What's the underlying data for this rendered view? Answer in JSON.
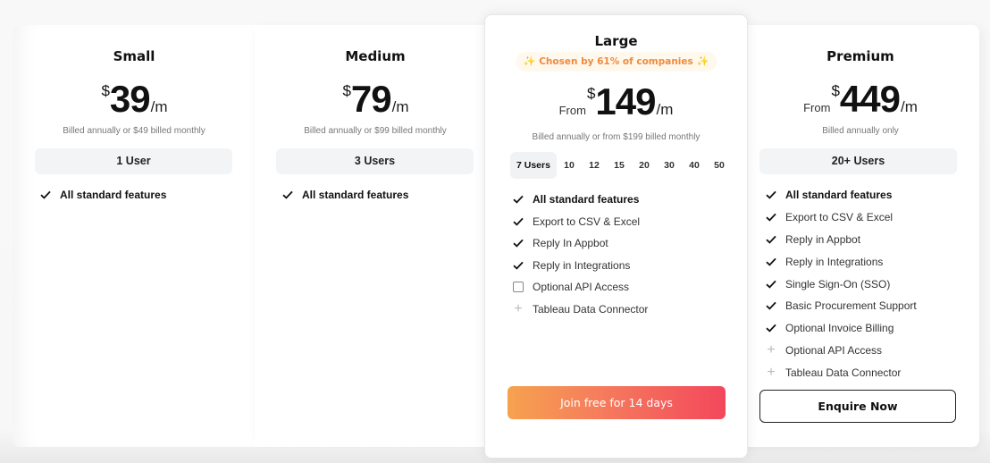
{
  "plans": {
    "small": {
      "name": "Small",
      "from": "",
      "currency": "$",
      "amount": "39",
      "period": "/m",
      "billing": "Billed annually or $49 billed monthly",
      "users": "1 User",
      "features": [
        {
          "label": "All standard features",
          "icon": "check-icon",
          "bold": true
        }
      ]
    },
    "medium": {
      "name": "Medium",
      "from": "",
      "currency": "$",
      "amount": "79",
      "period": "/m",
      "billing": "Billed annually or $99 billed monthly",
      "users": "3 Users",
      "features": [
        {
          "label": "All standard features",
          "icon": "check-icon",
          "bold": true
        }
      ]
    },
    "large": {
      "name": "Large",
      "badge": "Chosen by 61% of companies",
      "badge_icon": "sparkles-icon",
      "from": "From",
      "currency": "$",
      "amount": "149",
      "period": "/m",
      "billing": "Billed annually or from $199 billed monthly",
      "user_options": [
        "7 Users",
        "10",
        "12",
        "15",
        "20",
        "30",
        "40",
        "50"
      ],
      "selected_user_option": "7 Users",
      "features": [
        {
          "label": "All standard features",
          "icon": "check-icon",
          "bold": true
        },
        {
          "label": "Export to CSV & Excel",
          "icon": "check-icon",
          "bold": false
        },
        {
          "label": "Reply In Appbot",
          "icon": "check-icon",
          "bold": false
        },
        {
          "label": "Reply in Integrations",
          "icon": "check-icon",
          "bold": false
        },
        {
          "label": "Optional API Access",
          "icon": "checkbox-icon",
          "bold": false
        },
        {
          "label": "Tableau Data Connector",
          "icon": "plus-icon",
          "bold": false
        }
      ],
      "cta": "Join free for 14 days",
      "cta_gradient": [
        "#f6a24f",
        "#f3475c"
      ]
    },
    "premium": {
      "name": "Premium",
      "from": "From",
      "currency": "$",
      "amount": "449",
      "period": "/m",
      "billing": "Billed annually only",
      "users": "20+ Users",
      "features": [
        {
          "label": "All standard features",
          "icon": "check-icon",
          "bold": true
        },
        {
          "label": "Export to CSV & Excel",
          "icon": "check-icon",
          "bold": false
        },
        {
          "label": "Reply in Appbot",
          "icon": "check-icon",
          "bold": false
        },
        {
          "label": "Reply in Integrations",
          "icon": "check-icon",
          "bold": false
        },
        {
          "label": "Single Sign-On (SSO)",
          "icon": "check-icon",
          "bold": false
        },
        {
          "label": "Basic Procurement Support",
          "icon": "check-icon",
          "bold": false
        },
        {
          "label": "Optional Invoice Billing",
          "icon": "check-icon",
          "bold": false
        },
        {
          "label": "Optional API Access",
          "icon": "plus-icon",
          "bold": false
        },
        {
          "label": "Tableau Data Connector",
          "icon": "plus-icon",
          "bold": false
        }
      ],
      "cta": "Enquire Now"
    }
  },
  "colors": {
    "badge_text": "#f08a3c",
    "badge_bg": "#fff8ec",
    "users_box_bg": "#f3f4f6"
  }
}
